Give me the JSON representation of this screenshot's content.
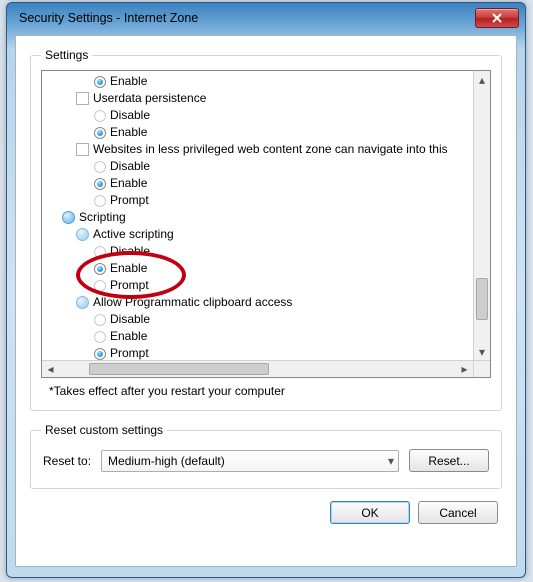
{
  "title": "Security Settings - Internet Zone",
  "groups": {
    "settings_legend": "Settings",
    "reset_legend": "Reset custom settings"
  },
  "tree": {
    "r0": {
      "label": "Enable",
      "selected": true
    },
    "b1": {
      "label": "Userdata persistence"
    },
    "r1a": {
      "label": "Disable",
      "selected": false
    },
    "r1b": {
      "label": "Enable",
      "selected": true
    },
    "b2": {
      "label": "Websites in less privileged web content zone can navigate into this"
    },
    "r2a": {
      "label": "Disable",
      "selected": false
    },
    "r2b": {
      "label": "Enable",
      "selected": true
    },
    "r2c": {
      "label": "Prompt",
      "selected": false
    },
    "cat": {
      "label": "Scripting"
    },
    "b3": {
      "label": "Active scripting"
    },
    "r3a": {
      "label": "Disable",
      "selected": false
    },
    "r3b": {
      "label": "Enable",
      "selected": true
    },
    "r3c": {
      "label": "Prompt",
      "selected": false
    },
    "b4": {
      "label": "Allow Programmatic clipboard access"
    },
    "r4a": {
      "label": "Disable",
      "selected": false
    },
    "r4b": {
      "label": "Enable",
      "selected": false
    },
    "r4c": {
      "label": "Prompt",
      "selected": true
    }
  },
  "note": "*Takes effect after you restart your computer",
  "reset": {
    "label": "Reset to:",
    "value": "Medium-high (default)",
    "button": "Reset..."
  },
  "buttons": {
    "ok": "OK",
    "cancel": "Cancel"
  },
  "annotation": {
    "ellipse_target": "Active scripting → Enable (highlighted with red ellipse)",
    "color": "#c00010"
  }
}
